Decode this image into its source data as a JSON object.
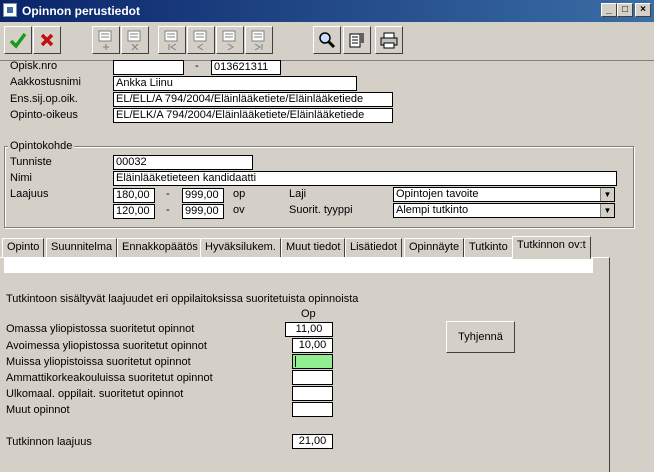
{
  "window": {
    "title": "Opinnon perustiedot",
    "controls": [
      "_",
      "□",
      "×"
    ]
  },
  "toolbar": {
    "buttons": [
      "save-icon",
      "cancel-icon",
      "new-record-icon",
      "delete-record-icon",
      "first-record-icon",
      "prev-record-icon",
      "next-record-icon",
      "last-record-icon",
      "search-icon",
      "notes-icon",
      "print-icon"
    ]
  },
  "student": {
    "opiskno_label": "Opisk.nro",
    "opiskno_value": "",
    "dash": "-",
    "opiskno2_value": "013621311",
    "name_label": "Aakkostusnimi",
    "name_value": "Ankka Liinu",
    "enssij_label": "Ens.sij.op.oik.",
    "enssij_value": "EL/ELL/A 794/2004/Eläinlääketiete/Eläinlääketiede",
    "opoik_label": "Opinto-oikeus",
    "opoik_value": "EL/ELK/A 794/2004/Eläinlääketiete/Eläinlääketiede"
  },
  "target": {
    "group_title": "Opintokohde",
    "tunniste_label": "Tunniste",
    "tunniste_value": "00032",
    "nimi_label": "Nimi",
    "nimi_value": "Eläinlääketieteen kandidaatti",
    "laajuus_label": "Laajuus",
    "op_min": "180,00",
    "op_max": "999,00",
    "op_unit": "op",
    "ov_min": "120,00",
    "ov_max": "999,00",
    "ov_unit": "ov",
    "dash": "-",
    "laji_label": "Laji",
    "laji_value": "Opintojen tavoite",
    "suorit_label": "Suorit. tyyppi",
    "suorit_value": "Alempi tutkinto"
  },
  "tabs": [
    "Opinto",
    "Suunnitelma",
    "Ennakkopäätös",
    "Hyväksilukem.",
    "Muut tiedot",
    "Lisätiedot",
    "Opinnäyte",
    "Tutkinto",
    "Tutkinnon ov:t"
  ],
  "active_tab": "Tutkinnon ov:t",
  "panel": {
    "heading": "Tutkintoon sisältyvät laajuudet eri oppilaitoksissa suoritetuista opinnoista",
    "col_header": "Op",
    "rows": [
      {
        "label": "Omassa yliopistossa suoritetut opinnot",
        "value": "11,00"
      },
      {
        "label": "Avoimessa yliopistossa suoritetut opinnot",
        "value": "10,00"
      },
      {
        "label": "Muissa yliopistoissa suoritetut opinnot",
        "value": ""
      },
      {
        "label": "Ammattikorkeakouluissa suoritetut opinnot",
        "value": ""
      },
      {
        "label": "Ulkomaal. oppilait. suoritetut opinnot",
        "value": ""
      },
      {
        "label": "Muut opinnot",
        "value": ""
      }
    ],
    "total_label": "Tutkinnon laajuus",
    "total_value": "21,00",
    "clear_button": "Tyhjennä",
    "focus_color": "#90ee90"
  }
}
